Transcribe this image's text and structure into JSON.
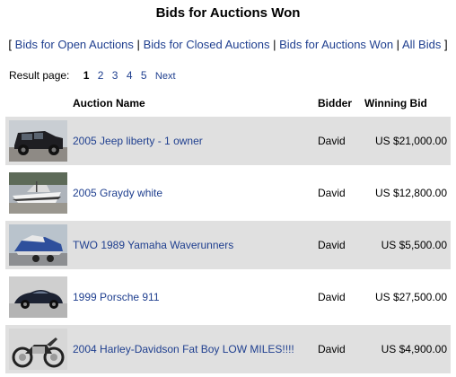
{
  "page": {
    "title": "Bids for Auctions Won"
  },
  "nav": {
    "open_bracket": "[",
    "close_bracket": "]",
    "separator": "|",
    "links": [
      "Bids for Open Auctions",
      "Bids for Closed Auctions",
      "Bids for Auctions Won",
      "All Bids"
    ]
  },
  "pagination": {
    "label": "Result page:",
    "current": "1",
    "pages": [
      "2",
      "3",
      "4",
      "5"
    ],
    "next": "Next"
  },
  "table": {
    "headers": {
      "name": "Auction Name",
      "bidder": "Bidder",
      "bid": "Winning Bid"
    },
    "rows": [
      {
        "name": "2005 Jeep liberty - 1 owner",
        "bidder": "David",
        "bid": "US $21,000.00",
        "thumb": "jeep-photo"
      },
      {
        "name": "2005 Graydy white",
        "bidder": "David",
        "bid": "US $12,800.00",
        "thumb": "boat-photo"
      },
      {
        "name": "TWO 1989 Yamaha Waverunners",
        "bidder": "David",
        "bid": "US $5,500.00",
        "thumb": "waverunner-photo"
      },
      {
        "name": "1999 Porsche 911",
        "bidder": "David",
        "bid": "US $27,500.00",
        "thumb": "porsche-photo"
      },
      {
        "name": "2004 Harley-Davidson Fat Boy LOW MILES!!!!",
        "bidder": "David",
        "bid": "US $4,900.00",
        "thumb": "motorcycle-photo"
      }
    ]
  }
}
